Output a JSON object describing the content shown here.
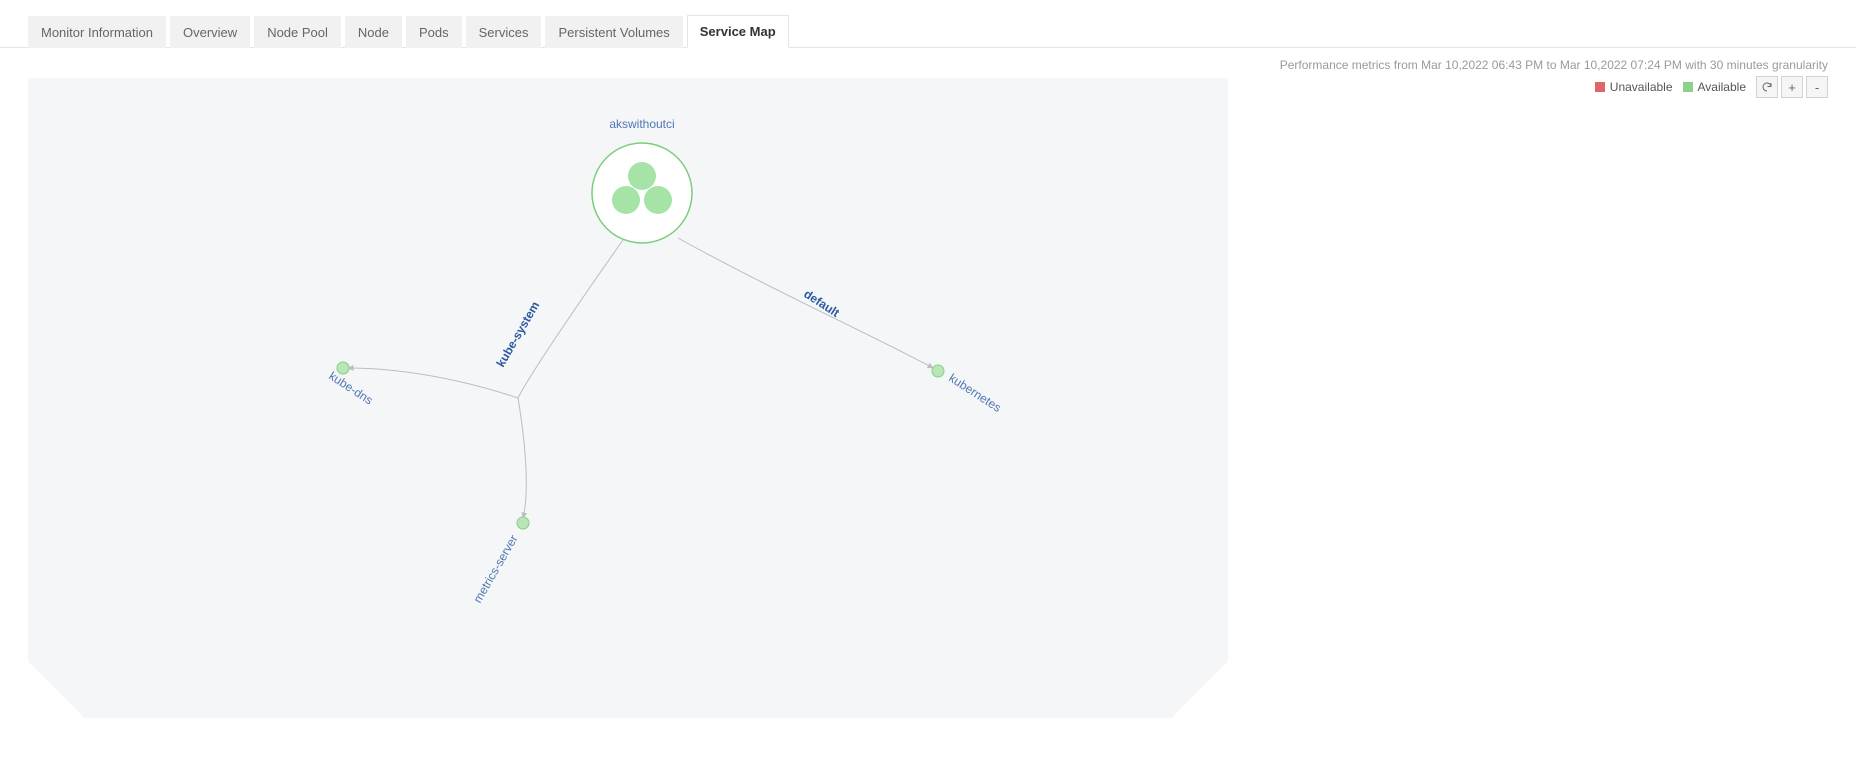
{
  "tabs": [
    {
      "label": "Monitor Information",
      "active": false
    },
    {
      "label": "Overview",
      "active": false
    },
    {
      "label": "Node Pool",
      "active": false
    },
    {
      "label": "Node",
      "active": false
    },
    {
      "label": "Pods",
      "active": false
    },
    {
      "label": "Services",
      "active": false
    },
    {
      "label": "Persistent Volumes",
      "active": false
    },
    {
      "label": "Service Map",
      "active": true
    }
  ],
  "metrics_line": "Performance metrics from Mar 10,2022 06:43 PM to Mar 10,2022 07:24 PM with 30 minutes granularity",
  "legend": {
    "unavailable": "Unavailable",
    "available": "Available"
  },
  "controls": {
    "refresh": "refresh",
    "zoom_in": "+",
    "zoom_out": "-"
  },
  "map": {
    "root": {
      "label": "akswithoutci"
    },
    "edges": [
      {
        "label": "kube-system"
      },
      {
        "label": "default"
      }
    ],
    "services": [
      {
        "label": "kube-dns"
      },
      {
        "label": "metrics-server"
      },
      {
        "label": "kubernetes"
      }
    ]
  }
}
